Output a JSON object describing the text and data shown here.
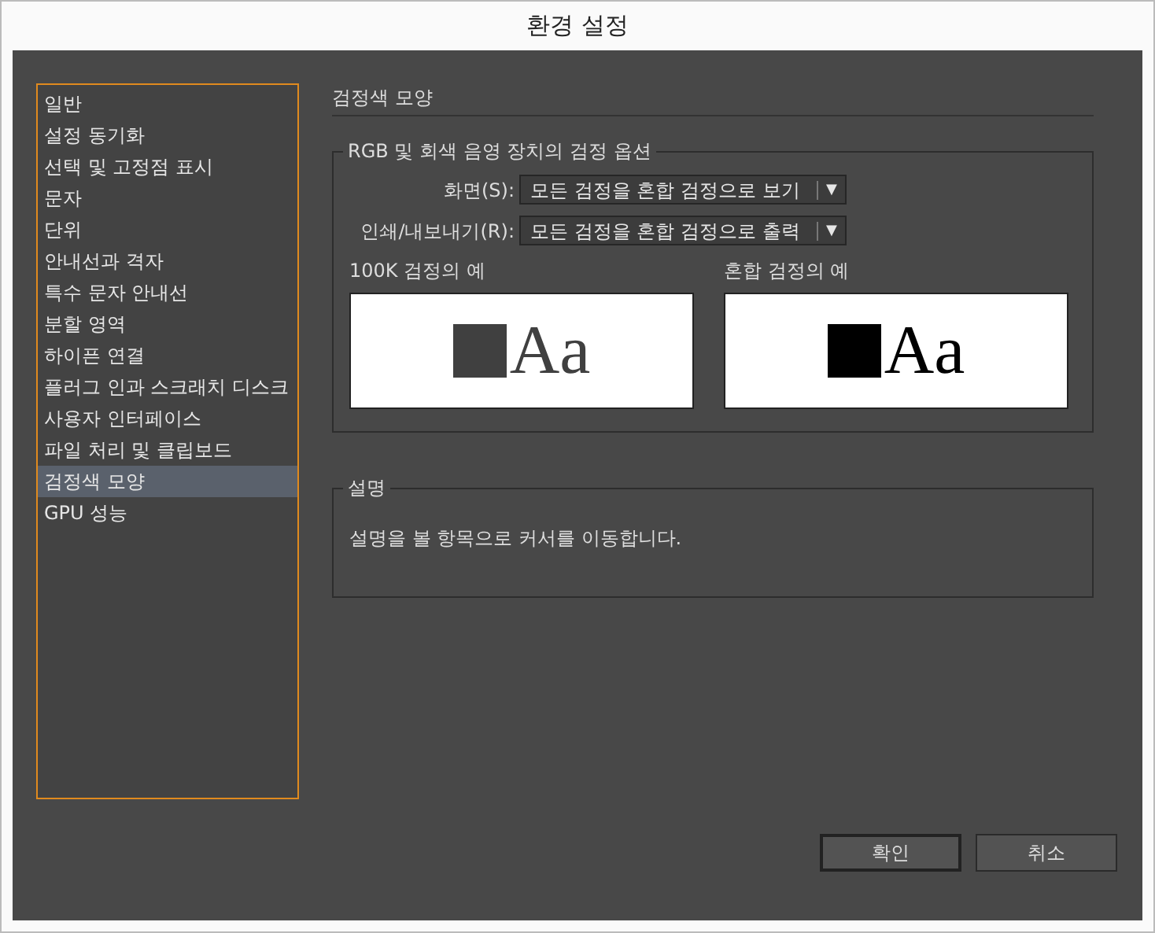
{
  "window": {
    "title": "환경 설정"
  },
  "sidebar": {
    "items": [
      {
        "label": "일반",
        "selected": false
      },
      {
        "label": "설정 동기화",
        "selected": false
      },
      {
        "label": "선택 및 고정점 표시",
        "selected": false
      },
      {
        "label": "문자",
        "selected": false
      },
      {
        "label": "단위",
        "selected": false
      },
      {
        "label": "안내선과 격자",
        "selected": false
      },
      {
        "label": "특수 문자 안내선",
        "selected": false
      },
      {
        "label": "분할 영역",
        "selected": false
      },
      {
        "label": "하이픈 연결",
        "selected": false
      },
      {
        "label": "플러그 인과 스크래치 디스크",
        "selected": false
      },
      {
        "label": "사용자 인터페이스",
        "selected": false
      },
      {
        "label": "파일 처리 및 클립보드",
        "selected": false
      },
      {
        "label": "검정색 모양",
        "selected": true
      },
      {
        "label": "GPU 성능",
        "selected": false
      }
    ]
  },
  "section_title": "검정색 모양",
  "options_group": {
    "legend": "RGB 및 회색 음영 장치의 검정 옵션",
    "fields": [
      {
        "label": "화면(S):",
        "value": "모든 검정을 혼합 검정으로 보기",
        "arrow": "▼"
      },
      {
        "label": "인쇄/내보내기(R):",
        "value": "모든 검정을 혼합 검정으로 출력",
        "arrow": "▼"
      }
    ],
    "samples": [
      {
        "label": "100K 검정의 예",
        "text": "Aa",
        "color": "#404040"
      },
      {
        "label": "혼합 검정의 예",
        "text": "Aa",
        "color": "#000000"
      }
    ]
  },
  "description": {
    "legend": "설명",
    "text": "설명을 볼 항목으로 커서를 이동합니다."
  },
  "buttons": [
    {
      "label": "확인",
      "default": true
    },
    {
      "label": "취소",
      "default": false
    }
  ]
}
